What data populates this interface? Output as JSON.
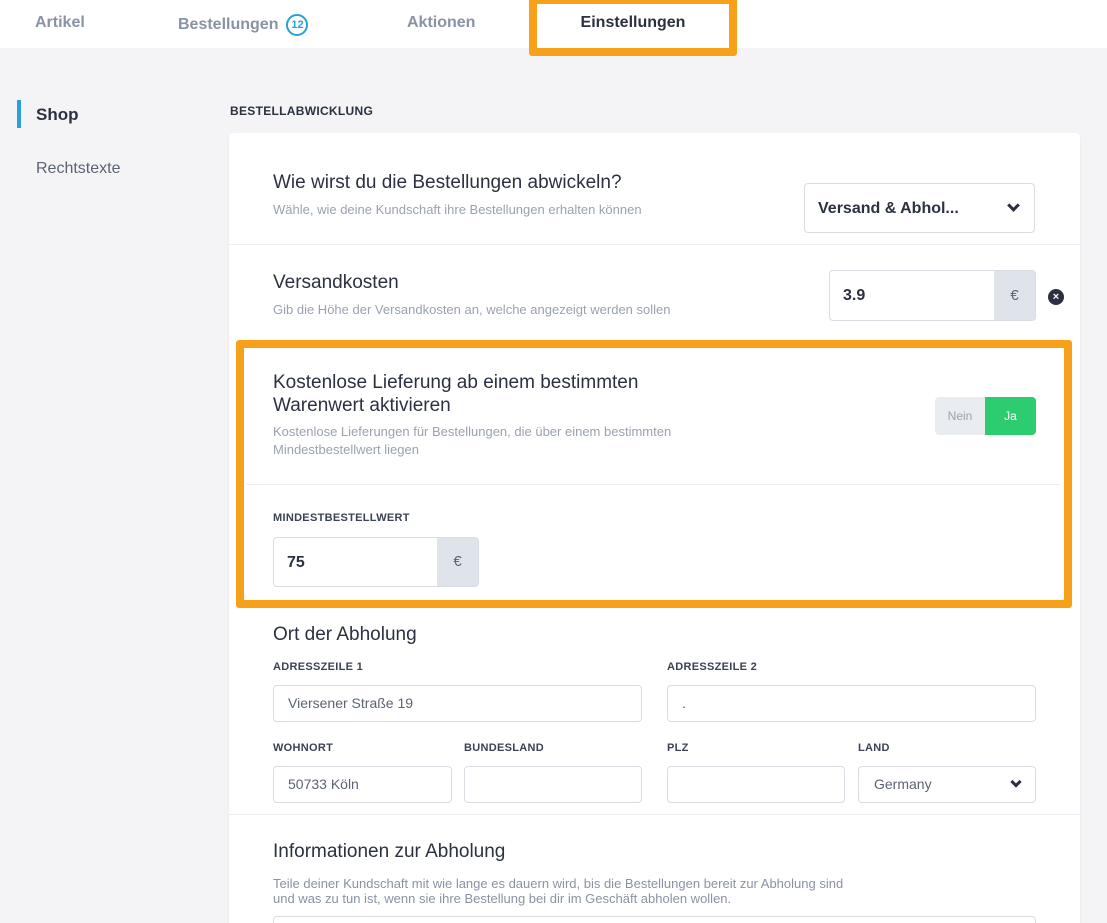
{
  "tabs": [
    {
      "label": "Artikel"
    },
    {
      "label": "Bestellungen",
      "badge": "12"
    },
    {
      "label": "Aktionen"
    },
    {
      "label": "Einstellungen",
      "active": true
    }
  ],
  "sidebar": {
    "items": [
      {
        "label": "Shop",
        "active": true
      },
      {
        "label": "Rechtstexte"
      }
    ]
  },
  "section_title": "BESTELLABWICKLUNG",
  "fulfillment": {
    "title": "Wie wirst du die Bestellungen abwickeln?",
    "subtitle": "Wähle, wie deine Kundschaft ihre Bestellungen erhalten können",
    "selected": "Versand & Abhol..."
  },
  "shipping": {
    "title": "Versandkosten",
    "subtitle": "Gib die Höhe der Versandkosten an, welche angezeigt werden sollen",
    "value": "3.9",
    "unit": "€"
  },
  "free_delivery": {
    "title_line1": "Kostenlose Lieferung ab einem bestimmten",
    "title_line2": "Warenwert aktivieren",
    "subtitle_line1": "Kostenlose Lieferungen für Bestellungen, die über einem bestimmten",
    "subtitle_line2": "Mindestbestellwert liegen",
    "toggle_no": "Nein",
    "toggle_yes": "Ja",
    "min_label": "MINDESTBESTELLWERT",
    "min_value": "75",
    "unit": "€"
  },
  "pickup": {
    "title": "Ort der Abholung",
    "address1_label": "ADRESSZEILE 1",
    "address1_value": "Viersener Straße 19",
    "address2_label": "ADRESSZEILE 2",
    "address2_value": ".",
    "city_label": "WOHNORT",
    "city_value": "50733 Köln",
    "state_label": "BUNDESLAND",
    "state_value": "",
    "zip_label": "PLZ",
    "zip_value": "",
    "country_label": "LAND",
    "country_value": "Germany"
  },
  "pickup_info": {
    "title": "Informationen zur Abholung",
    "line1": "Teile deiner Kundschaft mit wie lange es dauern wird, bis die Bestellungen bereit zur Abholung sind",
    "line2": "und was zu tun ist, wenn sie ihre Bestellung bei dir im Geschäft abholen wollen."
  },
  "colors": {
    "accent": "#2aa0d8",
    "highlight": "#f7a11a",
    "toggle_on": "#2ecc71"
  }
}
